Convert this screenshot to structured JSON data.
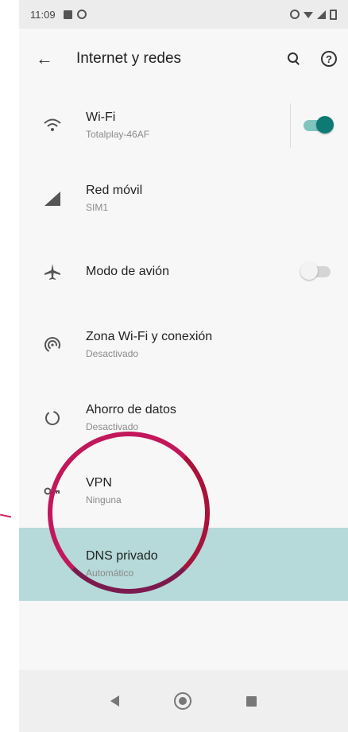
{
  "status_bar": {
    "time": "11:09",
    "left_icons": [
      "notification-icon",
      "whatsapp-icon"
    ],
    "right_icons": [
      "alarm-icon",
      "wifi-icon",
      "signal-icon",
      "battery-icon"
    ]
  },
  "app_bar": {
    "title": "Internet y redes",
    "back_icon": "arrow-back-icon",
    "actions": [
      "search-icon",
      "help-icon"
    ],
    "help_glyph": "?"
  },
  "settings": [
    {
      "id": "wifi",
      "label": "Wi-Fi",
      "summary": "Totalplay-46AF",
      "icon": "wifi-icon",
      "toggle": true
    },
    {
      "id": "mobile",
      "label": "Red móvil",
      "summary": "SIM1",
      "icon": "signal-icon"
    },
    {
      "id": "airplane",
      "label": "Modo de avión",
      "summary": "",
      "icon": "airplane-icon",
      "toggle": false
    },
    {
      "id": "hotspot",
      "label": "Zona Wi-Fi y conexión",
      "summary": "Desactivado",
      "icon": "hotspot-icon"
    },
    {
      "id": "datasaver",
      "label": "Ahorro de datos",
      "summary": "Desactivado",
      "icon": "data-saver-icon"
    },
    {
      "id": "vpn",
      "label": "VPN",
      "summary": "Ninguna",
      "icon": "vpn-key-icon"
    },
    {
      "id": "dns",
      "label": "DNS privado",
      "summary": "Automático",
      "icon": "",
      "highlighted": true
    }
  ],
  "nav_bar": [
    "back-icon",
    "home-icon",
    "recents-icon"
  ],
  "colors": {
    "accent": "#0e7a73",
    "highlight": "#b6d9d9",
    "annotation": "#c2185b"
  }
}
